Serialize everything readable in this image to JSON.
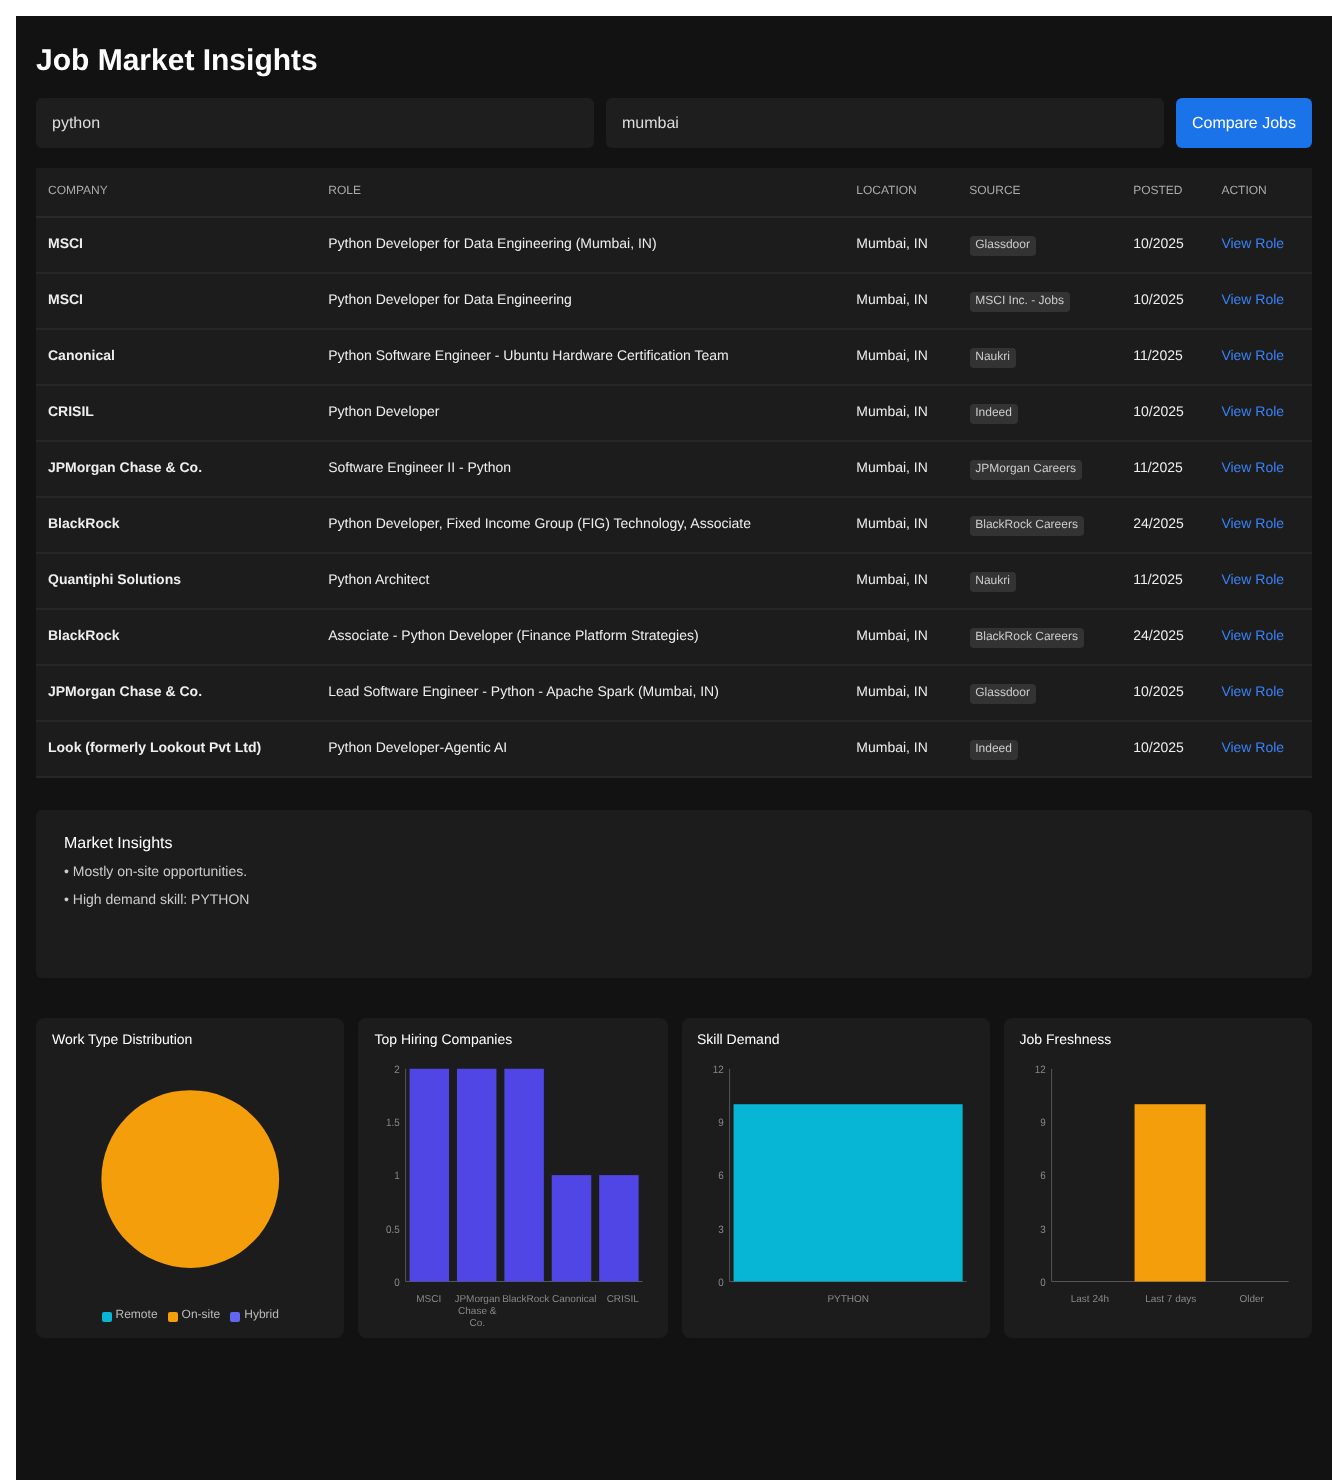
{
  "title": "Job Market Insights",
  "search": {
    "role": "python",
    "location": "mumbai",
    "button": "Compare Jobs"
  },
  "table": {
    "columns": [
      "COMPANY",
      "ROLE",
      "LOCATION",
      "SOURCE",
      "POSTED",
      "ACTION"
    ],
    "rows": [
      {
        "company": "MSCI",
        "role": "Python Developer for Data Engineering (Mumbai, IN)",
        "location": "Mumbai, IN",
        "source": "Glassdoor",
        "posted": "10/2025",
        "action": "View Role"
      },
      {
        "company": "MSCI",
        "role": "Python Developer for Data Engineering",
        "location": "Mumbai, IN",
        "source": "MSCI Inc. - Jobs",
        "posted": "10/2025",
        "action": "View Role"
      },
      {
        "company": "Canonical",
        "role": "Python Software Engineer - Ubuntu Hardware Certification Team",
        "location": "Mumbai, IN",
        "source": "Naukri",
        "posted": "11/2025",
        "action": "View Role"
      },
      {
        "company": "CRISIL",
        "role": "Python Developer",
        "location": "Mumbai, IN",
        "source": "Indeed",
        "posted": "10/2025",
        "action": "View Role"
      },
      {
        "company": "JPMorgan Chase & Co.",
        "role": "Software Engineer II - Python",
        "location": "Mumbai, IN",
        "source": "JPMorgan Careers",
        "posted": "11/2025",
        "action": "View Role"
      },
      {
        "company": "BlackRock",
        "role": "Python Developer, Fixed Income Group (FIG) Technology, Associate",
        "location": "Mumbai, IN",
        "source": "BlackRock Careers",
        "posted": "24/2025",
        "action": "View Role"
      },
      {
        "company": "Quantiphi Solutions",
        "role": "Python Architect",
        "location": "Mumbai, IN",
        "source": "Naukri",
        "posted": "11/2025",
        "action": "View Role"
      },
      {
        "company": "BlackRock",
        "role": "Associate - Python Developer (Finance Platform Strategies)",
        "location": "Mumbai, IN",
        "source": "BlackRock Careers",
        "posted": "24/2025",
        "action": "View Role"
      },
      {
        "company": "JPMorgan Chase & Co.",
        "role": "Lead Software Engineer - Python - Apache Spark (Mumbai, IN)",
        "location": "Mumbai, IN",
        "source": "Glassdoor",
        "posted": "10/2025",
        "action": "View Role"
      },
      {
        "company": "Look (formerly Lookout Pvt Ltd)",
        "role": "Python Developer-Agentic AI",
        "location": "Mumbai, IN",
        "source": "Indeed",
        "posted": "10/2025",
        "action": "View Role"
      }
    ]
  },
  "insights": {
    "title": "Market Insights",
    "items": [
      "• Mostly on-site opportunities.",
      "• High demand skill: PYTHON"
    ]
  },
  "charts": [
    {
      "title": "Work Type Distribution",
      "chart_data": {
        "type": "pie",
        "categories": [
          "Remote",
          "On-site",
          "Hybrid"
        ],
        "values": [
          0,
          100,
          0
        ],
        "colors": [
          "#06b6d4",
          "#f59e0b",
          "#6366f1"
        ]
      }
    },
    {
      "title": "Top Hiring Companies",
      "chart_data": {
        "type": "bar",
        "categories": [
          "MSCI",
          "JPMorgan Chase & Co.",
          "BlackRock",
          "Canonical",
          "CRISIL"
        ],
        "series": [
          {
            "color": "#4f46e5",
            "values": [
              2,
              2,
              2,
              1,
              1
            ]
          }
        ],
        "ylim": [
          0,
          2
        ],
        "yticks": [
          0,
          0.5,
          1,
          1.5,
          2
        ]
      }
    },
    {
      "title": "Skill Demand",
      "chart_data": {
        "type": "bar",
        "categories": [
          "PYTHON"
        ],
        "series": [
          {
            "color": "#06b6d4",
            "values": [
              10
            ]
          }
        ],
        "ylim": [
          0,
          12
        ],
        "yticks": [
          0,
          3,
          6,
          9,
          12
        ]
      }
    },
    {
      "title": "Job Freshness",
      "chart_data": {
        "type": "bar",
        "categories": [
          "Last 24h",
          "Last 7 days",
          "Older"
        ],
        "series": [
          {
            "color": "#f59e0b",
            "values": [
              0,
              10,
              0
            ]
          }
        ],
        "ylim": [
          0,
          12
        ],
        "yticks": [
          0,
          3,
          6,
          9,
          12
        ]
      }
    }
  ]
}
